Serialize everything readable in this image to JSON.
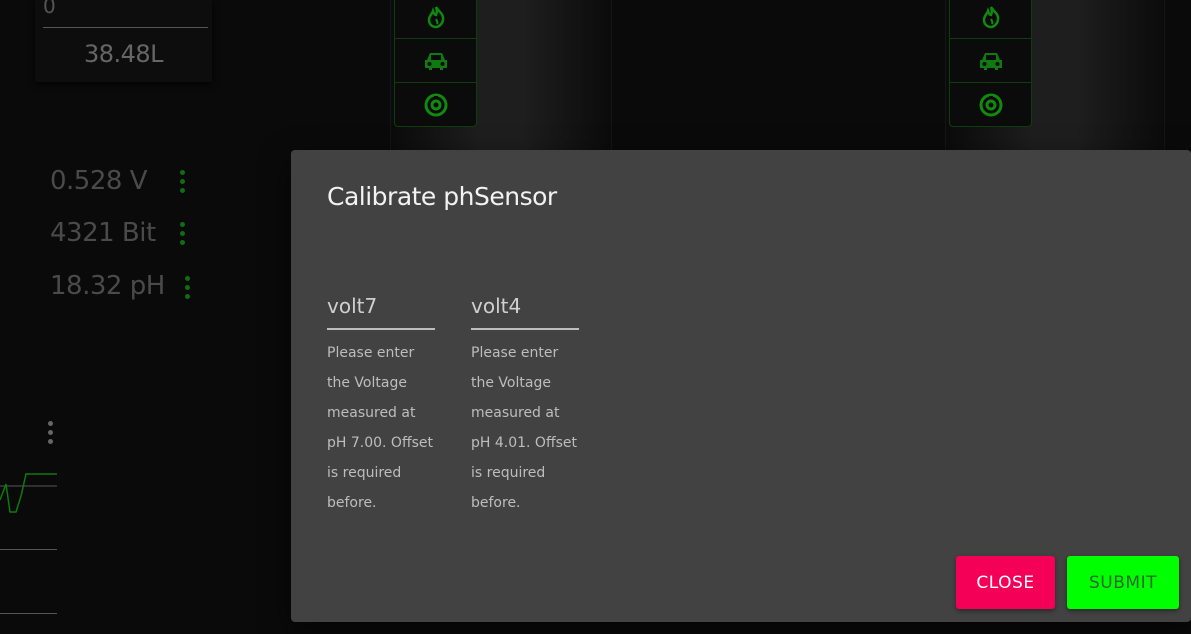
{
  "background": {
    "top_card": {
      "top_value": "0",
      "volume": "38.48L"
    },
    "readings": [
      {
        "value": "0.528 V"
      },
      {
        "value": "4321 Bit"
      },
      {
        "value": "18.32 pH"
      }
    ],
    "icon_stack_icons": [
      "flame-icon",
      "car-icon",
      "gauge-icon"
    ]
  },
  "dialog": {
    "title": "Calibrate phSensor",
    "fields": [
      {
        "label": "volt7",
        "help": "Please enter the Voltage measured at pH 7.00. Offset is required before."
      },
      {
        "label": "volt4",
        "help": "Please enter the Voltage measured at pH 4.01. Offset is required before."
      }
    ],
    "close_label": "CLOSE",
    "submit_label": "SUBMIT"
  },
  "colors": {
    "accent_green": "#00ff00",
    "close_pink": "#f50057",
    "dialog_bg": "#424242"
  }
}
